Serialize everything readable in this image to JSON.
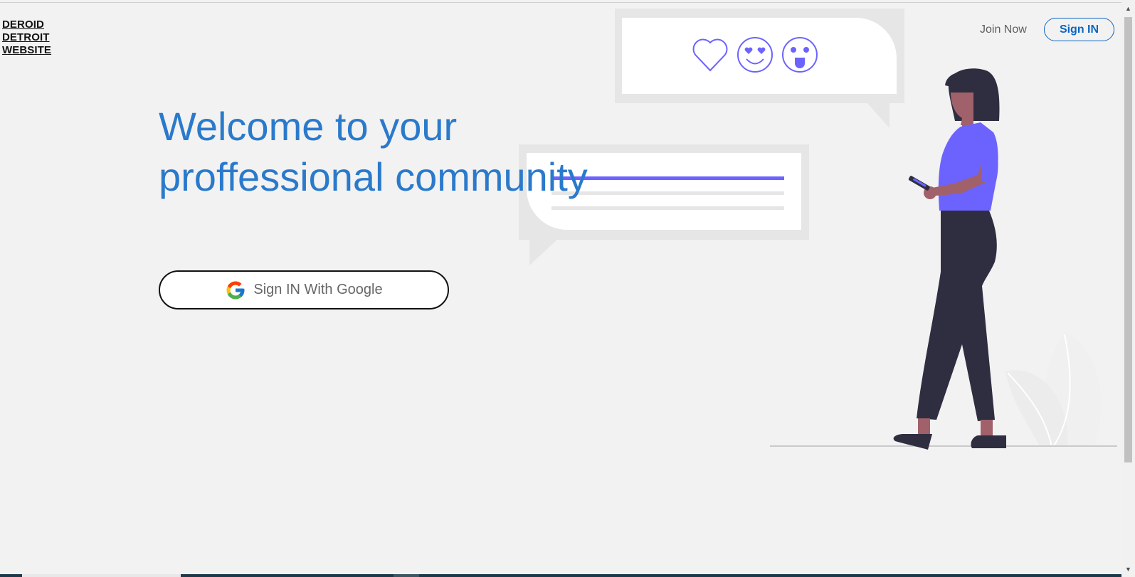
{
  "header": {
    "brand_lines": [
      "DEROID",
      "DETROIT",
      "WEBSITE"
    ],
    "join_label": "Join Now",
    "signin_label": "Sign IN"
  },
  "hero": {
    "title_line1": "Welcome to your",
    "title_line2": "proffessional community",
    "google_button_label": "Sign IN With Google"
  },
  "icons": {
    "google": "google-g-icon",
    "reactions": [
      "heart-icon",
      "heart-eyes-face-icon",
      "tongue-out-face-icon"
    ]
  },
  "colors": {
    "background": "#f3f2f2",
    "title_blue": "#2a7acb",
    "link_blue": "#0a66c2",
    "accent_purple": "#6c63ff",
    "bubble_gray": "#e6e6e6",
    "dark_figure": "#2f2e41",
    "skin": "#a0616a"
  }
}
